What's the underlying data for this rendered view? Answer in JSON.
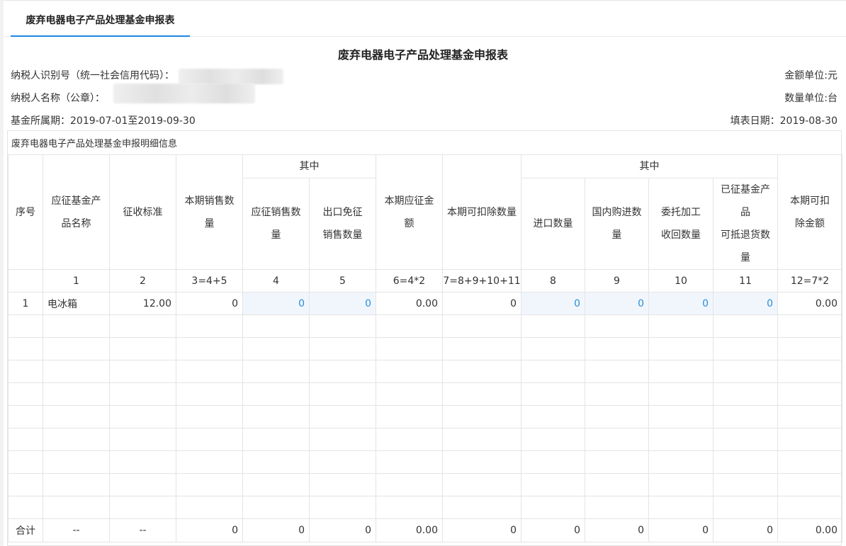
{
  "tab": {
    "label": "废弃电器电子产品处理基金申报表"
  },
  "report": {
    "title": "废弃电器电子产品处理基金申报表",
    "taxpayer_id_label": "纳税人识别号（统一社会信用代码）：",
    "taxpayer_name_label": "纳税人名称（公章）：",
    "period": "基金所属期：2019-07-01至2019-09-30",
    "amount_unit": "金额单位:元",
    "quantity_unit": "数量单位:台",
    "fill_date": "填表日期：2019-08-30"
  },
  "detail": {
    "section_title": "废弃电器电子产品处理基金申报明细信息",
    "headers": {
      "seq": "序号",
      "product_name": "应征基金产品名称",
      "standard": "征收标准",
      "period_sales": "本期销售数量",
      "group1": "其中",
      "taxable_sales": "应征销售数量",
      "export_exempt": "出口免征销售数量",
      "period_amount": "本期应征金额",
      "deductible_qty": "本期可扣除数量",
      "group2": "其中",
      "import_qty": "进口数量",
      "domestic_qty": "国内购进数量",
      "consigned_qty": "委托加工收回数量",
      "refund_qty": "已征基金产品可抵退货数量",
      "deductible_amount": "本期可扣除金额"
    },
    "header_lines": {
      "product_name": [
        "应征基金产",
        "品名称"
      ],
      "period_sales": [
        "本期销售数",
        "量"
      ],
      "taxable_sales": [
        "应征销售数",
        "量"
      ],
      "export_exempt": [
        "出口免征",
        "销售数量"
      ],
      "period_amount": [
        "本期应征金",
        "额"
      ],
      "domestic_qty": [
        "国内购进数",
        "量"
      ],
      "consigned_qty": [
        "委托加工",
        "收回数量"
      ],
      "refund_qty": [
        "已征基金产",
        "品",
        "可抵退货数",
        "量"
      ],
      "deductible_amount": [
        "本期可扣",
        "除金额"
      ]
    },
    "col_numbers": [
      "",
      "1",
      "2",
      "3=4+5",
      "4",
      "5",
      "6=4*2",
      "7=8+9+10+11",
      "8",
      "9",
      "10",
      "11",
      "12=7*2"
    ],
    "rows": [
      [
        "1",
        "电冰箱",
        "12.00",
        "0",
        "0",
        "0",
        "0.00",
        "0",
        "0",
        "0",
        "0",
        "0",
        "0.00"
      ]
    ],
    "empty_row_count": 9,
    "total_row": [
      "合计",
      "--",
      "--",
      "0",
      "0",
      "0",
      "0.00",
      "0",
      "0",
      "0",
      "0",
      "0",
      "0.00"
    ]
  },
  "colors": {
    "accent": "#1e88e5",
    "editable_text": "#2a8fd8",
    "editable_bg": "#f1f6fd"
  }
}
